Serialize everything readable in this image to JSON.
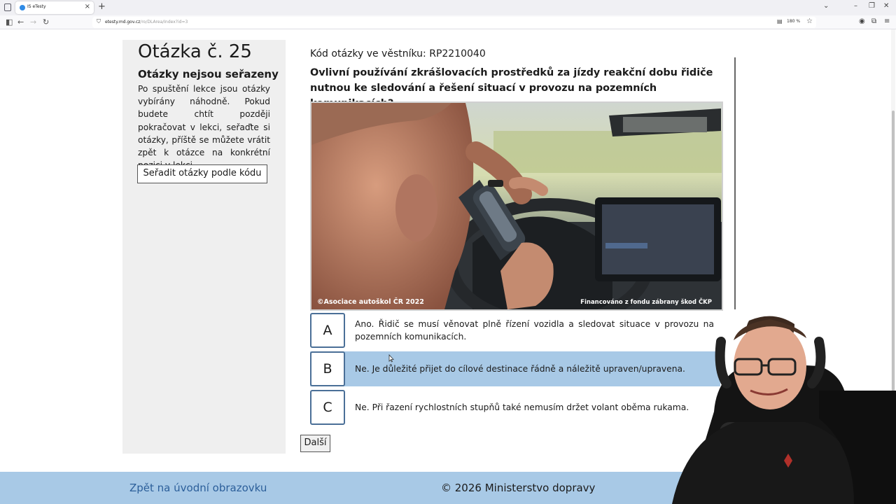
{
  "browser": {
    "tab_title": "IS eTesty",
    "url_host": "etesty.md.gov.cz",
    "url_path": "/ro/DLArea/Index?id=3",
    "url_prefix": "",
    "zoom": "180 %"
  },
  "sidebar": {
    "question_number": "Otázka č. 25",
    "unsorted_heading": "Otázky nejsou seřazeny",
    "unsorted_text": "Po spuštění lekce jsou otázky vybírány náhodně. Pokud budete chtít později pokračovat v lekci, seřaďte si otázky, příště se můžete vrátit zpět k otázce na konkrétní pozici v lekci.",
    "sort_button": "Seřadit otázky podle kódu"
  },
  "question": {
    "code_line": "Kód otázky ve věstníku: RP2210040",
    "text": "Ovlivní používání zkrášlovacích prostředků za jízdy reakční dobu řidiče nutnou ke sledování a řešení situací v provozu na pozemních komunikacích?",
    "image_caption_left": "©Asociace autoškol ČR 2022",
    "image_caption_right": "Financováno z fondu zábrany škod ČKP"
  },
  "answers": [
    {
      "letter": "A",
      "text": "Ano. Řidič se musí věnovat plně řízení vozidla a sledovat situace v provozu na pozemních komunikacích.",
      "selected": false
    },
    {
      "letter": "B",
      "text": "Ne. Je důležité přijet do cílové destinace řádně a náležitě upraven/upravena.",
      "selected": true
    },
    {
      "letter": "C",
      "text": "Ne. Při řazení rychlostních stupňů také nemusím držet volant oběma rukama.",
      "selected": false
    }
  ],
  "next_button": "Další",
  "footer": {
    "back_link": "Zpět na úvodní obrazovku",
    "copyright": "© 2026 Ministerstvo dopravy"
  },
  "colors": {
    "selected_answer": "#a8c9e6",
    "footer_bg": "#a8c9e6",
    "letter_border": "#4a6f97",
    "sidebar_bg": "#efefef"
  }
}
